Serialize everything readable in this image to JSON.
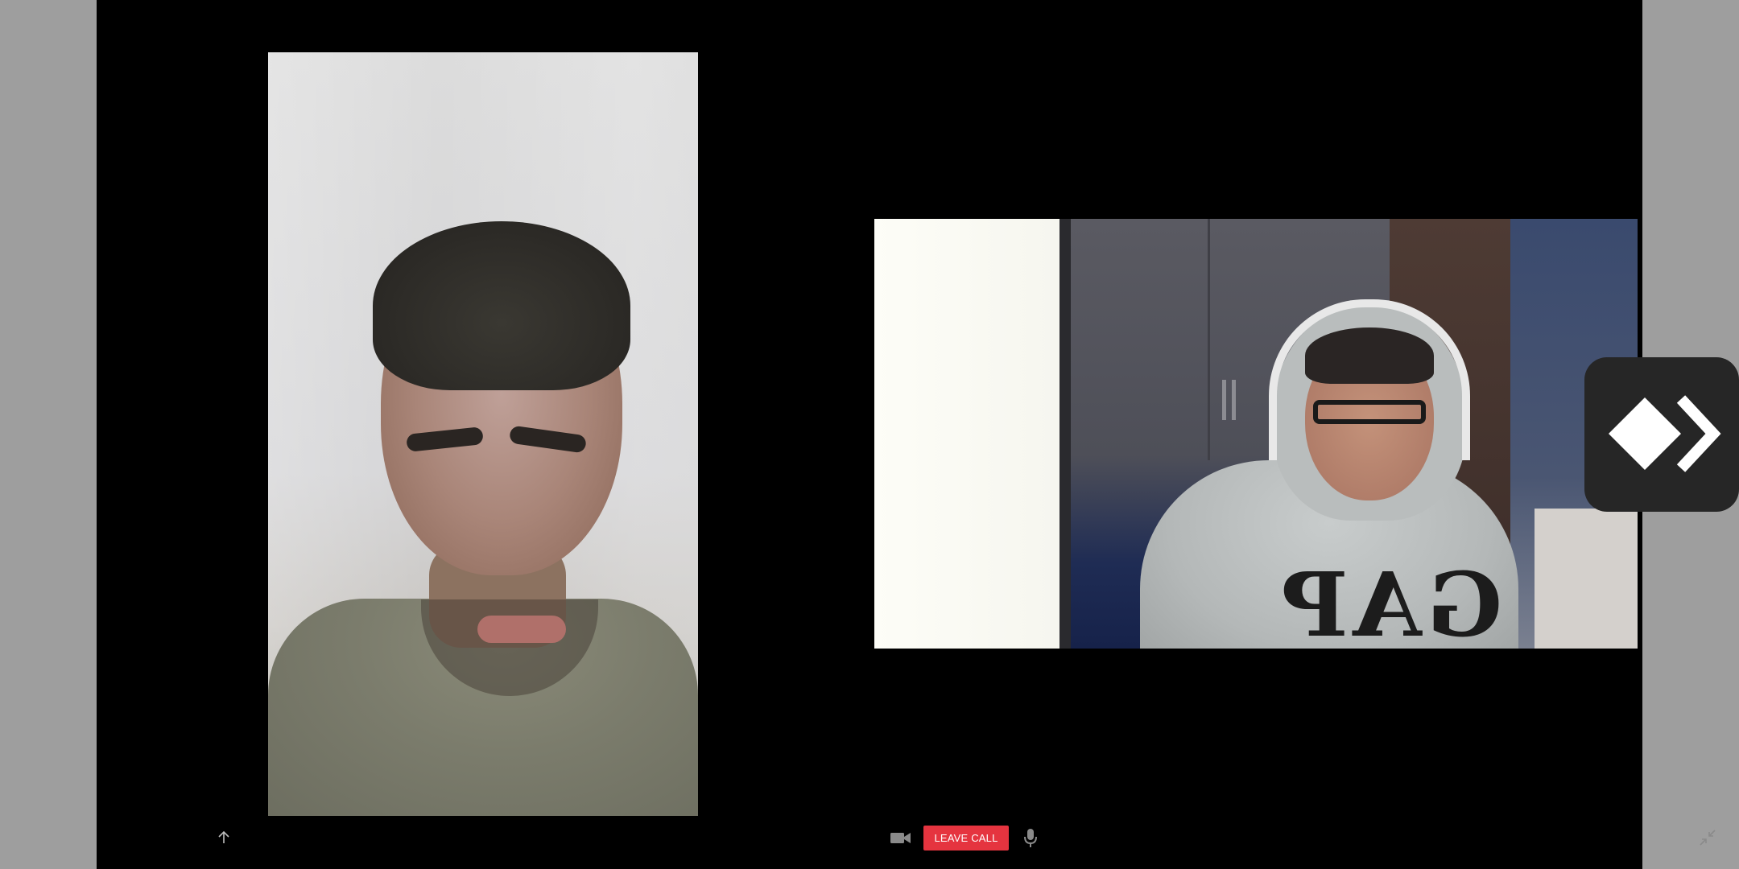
{
  "controls": {
    "leave_call_label": "LEAVE CALL",
    "leave_call_color": "#e5343f",
    "icons": {
      "scroll_up": "arrow-up-icon",
      "camera": "video-camera-icon",
      "microphone": "microphone-icon",
      "collapse": "collapse-arrows-icon"
    }
  },
  "overlay": {
    "icon": "forward-logo-icon"
  },
  "participants": [
    {
      "tile": "left-video"
    },
    {
      "tile": "right-video"
    }
  ],
  "right_video": {
    "hoodie_text": "GAP"
  }
}
